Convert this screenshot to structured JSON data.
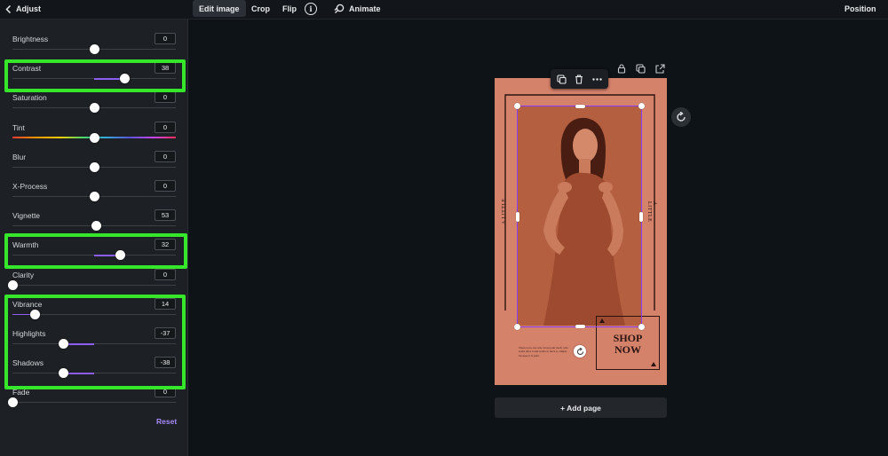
{
  "topbar": {
    "back_label": "Adjust",
    "tabs": [
      {
        "label": "Edit image"
      },
      {
        "label": "Crop"
      },
      {
        "label": "Flip"
      }
    ],
    "info_glyph": "i",
    "animate_label": "Animate",
    "position_label": "Position"
  },
  "panel": {
    "adjustments": [
      {
        "label": "Brightness",
        "value": "0",
        "level": 0,
        "range": [
          -100,
          100
        ],
        "kind": "plain"
      },
      {
        "label": "Contrast",
        "value": "38",
        "level": 38,
        "range": [
          -100,
          100
        ],
        "kind": "plain"
      },
      {
        "label": "Saturation",
        "value": "0",
        "level": 0,
        "range": [
          -100,
          100
        ],
        "kind": "plain"
      },
      {
        "label": "Tint",
        "value": "0",
        "level": 0,
        "range": [
          -100,
          100
        ],
        "kind": "rainbow"
      },
      {
        "label": "Blur",
        "value": "0",
        "level": 0,
        "range": [
          -100,
          100
        ],
        "kind": "plain"
      },
      {
        "label": "X-Process",
        "value": "0",
        "level": 0,
        "range": [
          -100,
          100
        ],
        "kind": "plain"
      },
      {
        "label": "Vignette",
        "value": "53",
        "level": 3,
        "range": [
          -100,
          100
        ],
        "kind": "plain"
      },
      {
        "label": "Warmth",
        "value": "32",
        "level": 32,
        "range": [
          -100,
          100
        ],
        "kind": "plain"
      },
      {
        "label": "Clarity",
        "value": "0",
        "level": 0,
        "range": [
          0,
          100
        ],
        "kind": "plain"
      },
      {
        "label": "Vibrance",
        "value": "14",
        "level": 14,
        "range": [
          0,
          100
        ],
        "kind": "plain"
      },
      {
        "label": "Highlights",
        "value": "-37",
        "level": -37,
        "range": [
          -100,
          100
        ],
        "kind": "plain"
      },
      {
        "label": "Shadows",
        "value": "-38",
        "level": -38,
        "range": [
          -100,
          100
        ],
        "kind": "plain"
      },
      {
        "label": "Fade",
        "value": "0",
        "level": 0,
        "range": [
          0,
          100
        ],
        "kind": "plain"
      }
    ],
    "highlighted": [
      "Contrast",
      "Warmth",
      "Vibrance",
      "Highlights",
      "Shadows"
    ],
    "reset_label": "Reset"
  },
  "design": {
    "side_text": "A LITTLE",
    "shop_text": "SHOP\nNOW",
    "blurb": "There is no one who loves pain itself, who seeks after it and wants to have it, simply because it is pain."
  },
  "add_page_label": "+ Add page",
  "colors": {
    "accent": "#8b3dff",
    "highlight": "#35e62b",
    "design_bg": "#d5826b",
    "photo_tint": "#b35a3e",
    "reset": "#a78bfa"
  },
  "icons": {
    "back": "chevron-left-icon",
    "info": "info-icon",
    "animate": "animate-icon",
    "duplicate": "duplicate-icon",
    "delete": "trash-icon",
    "more": "more-icon",
    "lock": "lock-icon",
    "copy_page": "copy-page-icon",
    "share": "share-icon",
    "rotate": "rotate-icon",
    "refresh": "refresh-icon"
  }
}
